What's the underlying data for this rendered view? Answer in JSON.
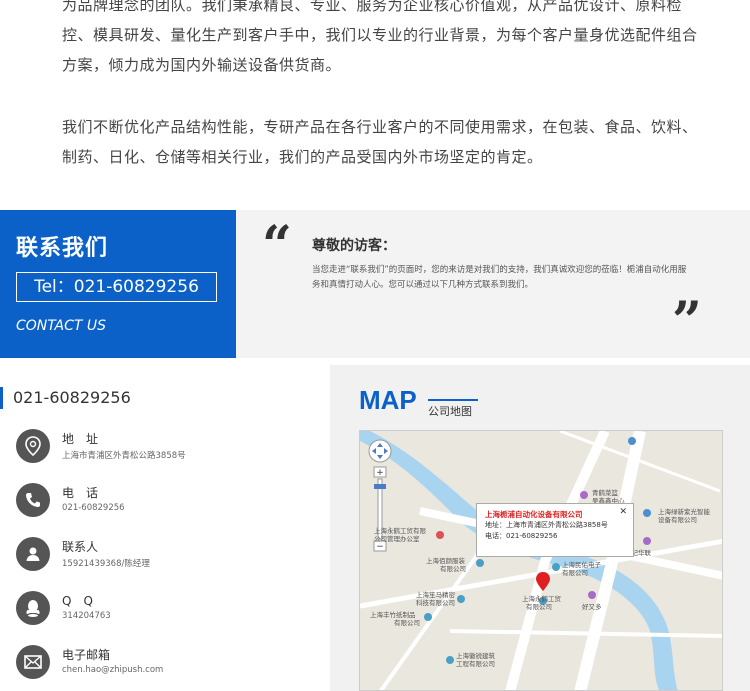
{
  "intro": {
    "p1": "为品牌理念的团队。我们秉承精良、专业、服务为企业核心价值观，从产品优设计、原料检控、模具研发、量化生产到客户手中，我们以专业的行业背景，为每个客户量身优选配件组合方案，倾力成为国内外输送设备供货商。",
    "p2": "我们不断优化产品结构性能，专研产品在各行业客户的不同使用需求，在包装、食品、饮料、制药、日化、仓储等相关行业，我们的产品受国内外市场坚定的肯定。"
  },
  "banner": {
    "title": "联系我们",
    "tel": "Tel：021-60829256",
    "en": "CONTACT US",
    "greet_title": "尊敬的访客：",
    "greet_body": "当您走进“联系我们”的页面时，您的来访是对我们的支持，我们真诚欢迎您的莅临！栀浦自动化用服务和真情打动人心。您可以通过以下几种方式联系到我们。"
  },
  "contact": {
    "phone": "021-60829256",
    "items": [
      {
        "label": "地　址",
        "value": "上海市青浦区外青松公路3858号",
        "icon": "location-icon"
      },
      {
        "label": "电　话",
        "value": "021-60829256",
        "icon": "phone-icon"
      },
      {
        "label": "联系人",
        "value": "15921439368/陈经理",
        "icon": "person-icon"
      },
      {
        "label": "Q　Q",
        "value": "314204763",
        "icon": "qq-icon"
      },
      {
        "label": "电子邮箱",
        "value": "chen.hao@zhipush.com",
        "icon": "mail-icon"
      }
    ]
  },
  "map": {
    "title": "MAP",
    "subtitle": "公司地图",
    "popup": {
      "name": "上海栀浦自动化设备有限公司",
      "address": "地址：上海市青浦区外青松公路3858号",
      "phone": "电话：021-60829256"
    },
    "labels": [
      "青鹤菜篮",
      "吴鑫鑫中心",
      "上海绿新紫光智能",
      "设备有限公司",
      "世纪华联",
      "上海永鹤工贸有限",
      "公司管理办公室",
      "上海佰颜服装",
      "有限公司",
      "上海民佑电子",
      "有限公司",
      "上海笙马精密",
      "科技有限公司",
      "上海永鹤工贸",
      "有限公司",
      "好又多",
      "上海丰竹纸制品",
      "有限公司",
      "上海徽锐建筑",
      "工程有限公司"
    ]
  }
}
